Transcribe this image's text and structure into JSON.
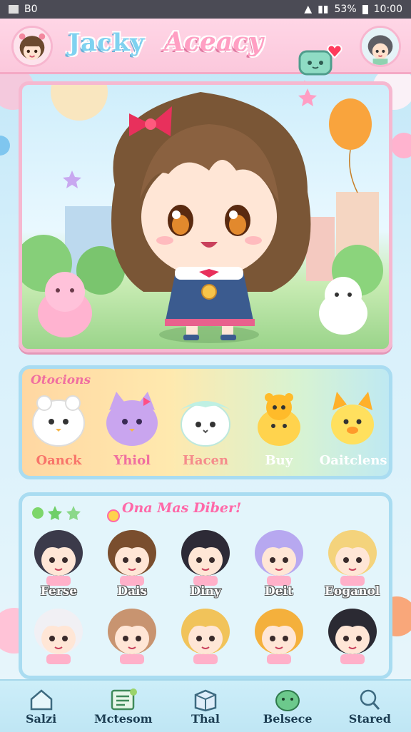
{
  "statusbar": {
    "left": "B0",
    "battery": "53%",
    "time": "10:00"
  },
  "header": {
    "title1": "Jacky",
    "title2": "Aceacy"
  },
  "section1": {
    "title": "Otocions",
    "pets": [
      {
        "label": "Oanck",
        "icon": "white-bunny-icon",
        "color": "#ffffff"
      },
      {
        "label": "Yhiol",
        "icon": "purple-cat-icon",
        "color": "#c9a5ef"
      },
      {
        "label": "Hacen",
        "icon": "mint-kitty-icon",
        "color": "#d8f3ee"
      },
      {
        "label": "Buy",
        "icon": "yellow-bear-icon",
        "color": "#ffd34d"
      },
      {
        "label": "Oaitclens",
        "icon": "yellow-fox-icon",
        "color": "#ffe05e"
      }
    ]
  },
  "section2": {
    "title": "Ona Mas Diber!",
    "friends": [
      {
        "label": "Ferse",
        "hair": "#3b3a4a"
      },
      {
        "label": "Dais",
        "hair": "#7a4e2e"
      },
      {
        "label": "Diny",
        "hair": "#2d2a36"
      },
      {
        "label": "Deit",
        "hair": "#b7a8f0"
      },
      {
        "label": "Eoganol",
        "hair": "#f4d37c"
      },
      {
        "label": "",
        "hair": "#f1f0f4"
      },
      {
        "label": "",
        "hair": "#c89470"
      },
      {
        "label": "",
        "hair": "#f1c35a"
      },
      {
        "label": "",
        "hair": "#f4b03c"
      },
      {
        "label": "",
        "hair": "#2b2a33"
      }
    ]
  },
  "nav": [
    {
      "label": "Salzi",
      "icon": "home-icon"
    },
    {
      "label": "Mctesom",
      "icon": "list-icon"
    },
    {
      "label": "Thal",
      "icon": "box-icon"
    },
    {
      "label": "Belsece",
      "icon": "pet-icon"
    },
    {
      "label": "Stared",
      "icon": "search-icon"
    }
  ]
}
